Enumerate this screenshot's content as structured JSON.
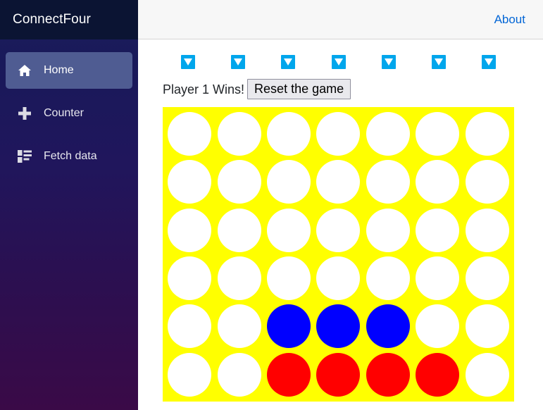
{
  "sidebar": {
    "brand_title": "ConnectFour",
    "items": [
      {
        "label": "Home",
        "icon": "home-icon",
        "active": true
      },
      {
        "label": "Counter",
        "icon": "plus-icon",
        "active": false
      },
      {
        "label": "Fetch data",
        "icon": "list-icon",
        "active": false
      }
    ]
  },
  "topbar": {
    "about_label": "About"
  },
  "game": {
    "status_text": "Player 1 Wins!",
    "reset_label": "Reset the game",
    "columns": 7,
    "rows": 6,
    "drop_arrow_icon": "triangle-down-icon",
    "drop_arrow_count": 7,
    "colors": {
      "board": "#ffff00",
      "empty": "#ffffff",
      "player1": "#ff0000",
      "player2": "#0000ff",
      "drop_button": "#00a6ec"
    },
    "board_state": [
      [
        "empty",
        "empty",
        "empty",
        "empty",
        "empty",
        "empty",
        "empty"
      ],
      [
        "empty",
        "empty",
        "empty",
        "empty",
        "empty",
        "empty",
        "empty"
      ],
      [
        "empty",
        "empty",
        "empty",
        "empty",
        "empty",
        "empty",
        "empty"
      ],
      [
        "empty",
        "empty",
        "empty",
        "empty",
        "empty",
        "empty",
        "empty"
      ],
      [
        "empty",
        "empty",
        "blue",
        "blue",
        "blue",
        "empty",
        "empty"
      ],
      [
        "empty",
        "empty",
        "red",
        "red",
        "red",
        "red",
        "empty"
      ]
    ]
  }
}
